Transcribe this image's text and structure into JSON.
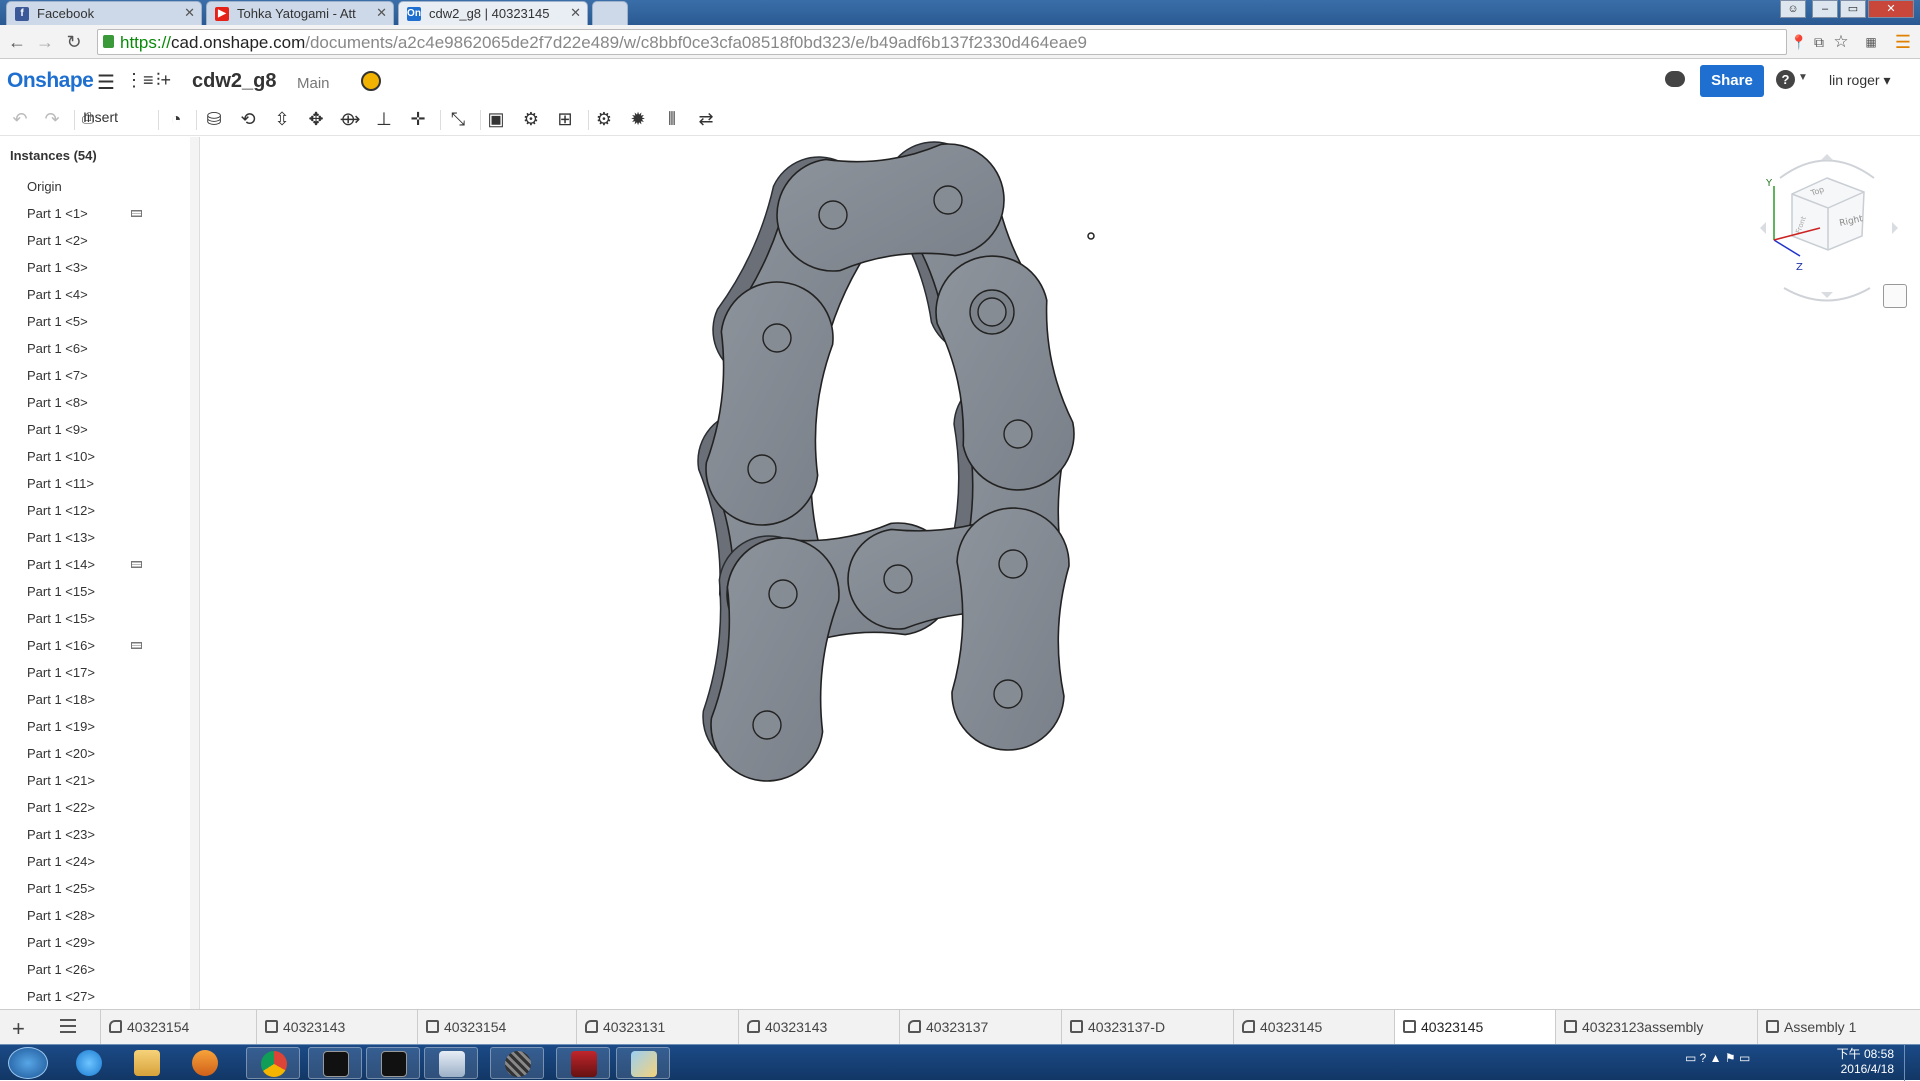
{
  "browser": {
    "tabs": [
      {
        "title": "Facebook",
        "favicon": "facebook-icon",
        "color": "#3b5998"
      },
      {
        "title": "Tohka Yatogami - Att",
        "favicon": "youtube-icon",
        "color": "#e62117"
      },
      {
        "title": "cdw2_g8 | 40323145",
        "favicon": "onshape-icon",
        "color": "#1e6fcf"
      }
    ],
    "url": {
      "scheme": "https://",
      "host": "cad.onshape.com",
      "path": "/documents/a2c4e9862065de2f7d22e489/w/c8bbf0ce3cfa08518f0bd323/e/b49adf6b137f2330d464eae9"
    }
  },
  "app": {
    "logo": "Onshape",
    "document_name": "cdw2_g8",
    "branch": "Main",
    "share_label": "Share",
    "help_label": "?",
    "user_menu": "lin roger ▾",
    "brand_color": "#1e6fcf"
  },
  "toolbar": {
    "insert_label": "Insert",
    "tools": [
      "undo-icon",
      "redo-icon",
      "insert-icon",
      "mate-connector-icon",
      "fastened-mate-icon",
      "revolute-mate-icon",
      "slider-mate-icon",
      "planar-mate-icon",
      "cylindrical-mate-icon",
      "pin-slot-mate-icon",
      "ball-mate-icon",
      "tangent-mate-icon",
      "group-icon",
      "replicate-icon",
      "linear-pattern-icon",
      "gear-relation-icon",
      "rack-pinion-icon",
      "screw-relation-icon",
      "linear-relation-icon",
      "explode-icon"
    ]
  },
  "instances": {
    "title": "Instances (54)",
    "items": [
      {
        "label": "Origin",
        "mate": false
      },
      {
        "label": "Part 1 <1>",
        "mate": true
      },
      {
        "label": "Part 1 <2>",
        "mate": false
      },
      {
        "label": "Part 1 <3>",
        "mate": false
      },
      {
        "label": "Part 1 <4>",
        "mate": false
      },
      {
        "label": "Part 1 <5>",
        "mate": false
      },
      {
        "label": "Part 1 <6>",
        "mate": false
      },
      {
        "label": "Part 1 <7>",
        "mate": false
      },
      {
        "label": "Part 1 <8>",
        "mate": false
      },
      {
        "label": "Part 1 <9>",
        "mate": false
      },
      {
        "label": "Part 1 <10>",
        "mate": false
      },
      {
        "label": "Part 1 <11>",
        "mate": false
      },
      {
        "label": "Part 1 <12>",
        "mate": false
      },
      {
        "label": "Part 1 <13>",
        "mate": false
      },
      {
        "label": "Part 1 <14>",
        "mate": true
      },
      {
        "label": "Part 1 <15>",
        "mate": false
      },
      {
        "label": "Part 1 <15>",
        "mate": false
      },
      {
        "label": "Part 1 <16>",
        "mate": true
      },
      {
        "label": "Part 1 <17>",
        "mate": false
      },
      {
        "label": "Part 1 <18>",
        "mate": false
      },
      {
        "label": "Part 1 <19>",
        "mate": false
      },
      {
        "label": "Part 1 <20>",
        "mate": false
      },
      {
        "label": "Part 1 <21>",
        "mate": false
      },
      {
        "label": "Part 1 <22>",
        "mate": false
      },
      {
        "label": "Part 1 <23>",
        "mate": false
      },
      {
        "label": "Part 1 <24>",
        "mate": false
      },
      {
        "label": "Part 1 <25>",
        "mate": false
      },
      {
        "label": "Part 1 <28>",
        "mate": false
      },
      {
        "label": "Part 1 <29>",
        "mate": false
      },
      {
        "label": "Part 1 <26>",
        "mate": false
      },
      {
        "label": "Part 1 <27>",
        "mate": false
      }
    ]
  },
  "viewcube": {
    "face_top": "Top",
    "face_front": "Front",
    "face_right": "Right",
    "axis_y": "Y",
    "axis_z": "Z"
  },
  "doc_tabs": [
    {
      "label": "40323154",
      "kind": "assembly",
      "active": false
    },
    {
      "label": "40323143",
      "kind": "part",
      "active": false
    },
    {
      "label": "40323154",
      "kind": "part",
      "active": false
    },
    {
      "label": "40323131",
      "kind": "assembly",
      "active": false
    },
    {
      "label": "40323143",
      "kind": "assembly",
      "active": false
    },
    {
      "label": "40323137",
      "kind": "assembly",
      "active": false
    },
    {
      "label": "40323137-D",
      "kind": "part",
      "active": false
    },
    {
      "label": "40323145",
      "kind": "assembly",
      "active": false
    },
    {
      "label": "40323145",
      "kind": "part",
      "active": true
    },
    {
      "label": "40323123assembly",
      "kind": "part",
      "active": false
    },
    {
      "label": "Assembly 1",
      "kind": "part",
      "active": false
    }
  ],
  "taskbar": {
    "apps": [
      "ie-icon",
      "explorer-icon",
      "media-player-icon",
      "chrome-icon",
      "cmd-icon",
      "cmd-icon",
      "notepad-icon",
      "sphere-app-icon",
      "game-icon",
      "paint-icon"
    ],
    "clock_time": "下午 08:58",
    "clock_date": "2016/4/18"
  }
}
